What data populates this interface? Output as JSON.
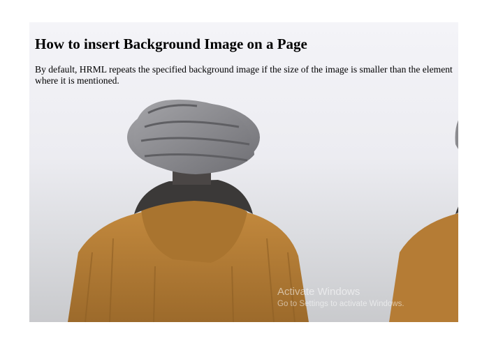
{
  "page": {
    "heading": "How to insert Background Image on a Page",
    "paragraph": "By default, HRML repeats the specified background image if the size of the image is smaller than the element where it is mentioned."
  },
  "background": {
    "image": "person-in-knit-beanie-and-mustard-corduroy-hooded-jacket",
    "repeat": "horizontal tile",
    "colors": {
      "sky": "#f2f2f6",
      "beanie": "#8b8b8f",
      "scarf": "#3b3938",
      "jacket": "#b77f37"
    }
  },
  "watermark": {
    "title": "Activate Windows",
    "subtitle": "Go to Settings to activate Windows."
  }
}
